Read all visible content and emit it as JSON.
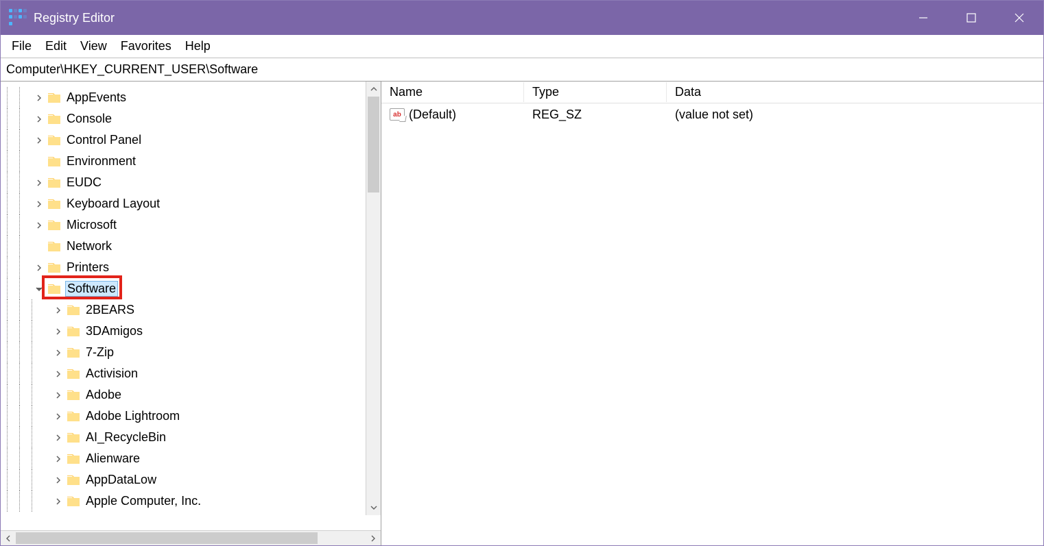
{
  "titlebar": {
    "title": "Registry Editor"
  },
  "menu": {
    "file": "File",
    "edit": "Edit",
    "view": "View",
    "favorites": "Favorites",
    "help": "Help"
  },
  "address": "Computer\\HKEY_CURRENT_USER\\Software",
  "tree": [
    {
      "label": "AppEvents",
      "level": 2,
      "expander": "closed"
    },
    {
      "label": "Console",
      "level": 2,
      "expander": "closed"
    },
    {
      "label": "Control Panel",
      "level": 2,
      "expander": "closed"
    },
    {
      "label": "Environment",
      "level": 2,
      "expander": "none"
    },
    {
      "label": "EUDC",
      "level": 2,
      "expander": "closed"
    },
    {
      "label": "Keyboard Layout",
      "level": 2,
      "expander": "closed"
    },
    {
      "label": "Microsoft",
      "level": 2,
      "expander": "closed"
    },
    {
      "label": "Network",
      "level": 2,
      "expander": "none"
    },
    {
      "label": "Printers",
      "level": 2,
      "expander": "closed"
    },
    {
      "label": "Software",
      "level": 2,
      "expander": "open",
      "selected": true,
      "highlight": true
    },
    {
      "label": "2BEARS",
      "level": 3,
      "expander": "closed"
    },
    {
      "label": "3DAmigos",
      "level": 3,
      "expander": "closed"
    },
    {
      "label": "7-Zip",
      "level": 3,
      "expander": "closed"
    },
    {
      "label": "Activision",
      "level": 3,
      "expander": "closed"
    },
    {
      "label": "Adobe",
      "level": 3,
      "expander": "closed"
    },
    {
      "label": "Adobe Lightroom",
      "level": 3,
      "expander": "closed"
    },
    {
      "label": "AI_RecycleBin",
      "level": 3,
      "expander": "closed"
    },
    {
      "label": "Alienware",
      "level": 3,
      "expander": "closed"
    },
    {
      "label": "AppDataLow",
      "level": 3,
      "expander": "closed"
    },
    {
      "label": "Apple Computer, Inc.",
      "level": 3,
      "expander": "closed"
    }
  ],
  "list": {
    "headers": {
      "name": "Name",
      "type": "Type",
      "data": "Data"
    },
    "rows": [
      {
        "name": "(Default)",
        "type": "REG_SZ",
        "data": "(value not set)",
        "icon_text": "ab"
      }
    ]
  }
}
